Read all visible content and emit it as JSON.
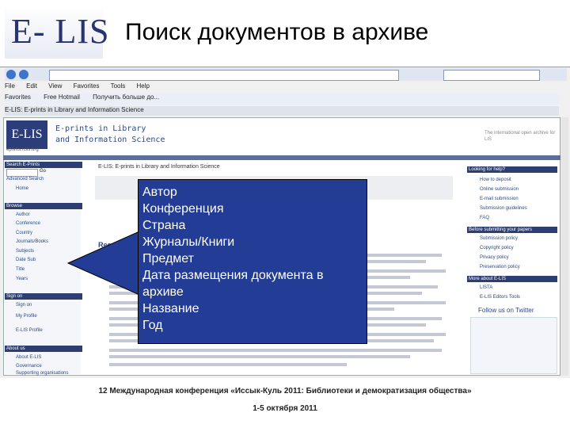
{
  "slide": {
    "logo_text": "E- LIS",
    "title": "Поиск документов в архиве"
  },
  "browser": {
    "menu": [
      "File",
      "Edit",
      "View",
      "Favorites",
      "Tools",
      "Help"
    ],
    "favorites": [
      "Favorites",
      "Free Hotmail",
      "Получить больше до..."
    ],
    "tab": "E-LIS: E-prints in Library and Information Science"
  },
  "site": {
    "logo": "E-LIS",
    "url": "eprints.rclis.org",
    "title_line1": "E-prints in Library",
    "title_line2": "and Information Science",
    "right_text": "The international open archive for LIS",
    "breadcrumb": "E-LIS: E-prints in Library and Information Science",
    "recent_heading": "Recent su",
    "sidebar": {
      "search_head": "Search E-Prints",
      "go": "Go",
      "advanced": "Advanced Search",
      "home": "Home",
      "browse_head": "Browse",
      "browse_items": [
        "Author",
        "Conference",
        "Country",
        "Journals/Books",
        "Subjects",
        "Date Sub",
        "Title",
        "Years"
      ],
      "signon_head": "Sign on",
      "signon_items": [
        "Sign on",
        "My Profile",
        "E-LIS Profile"
      ],
      "about_head": "About us",
      "about_items": [
        "About E-LIS",
        "Governance",
        "Supporting organisations"
      ]
    },
    "right": {
      "help_head": "Looking for help?",
      "help_items": [
        "How to deposit",
        "Online submission",
        "E-mail submission",
        "Submission guidelines",
        "FAQ"
      ],
      "support_head": "Before submitting your papers",
      "support_items": [
        "Submission policy",
        "Copyright policy",
        "Privacy policy",
        "Preservation policy"
      ],
      "more_head": "More about E-LIS",
      "more_items": [
        "LISTA",
        "E-LIS Editors Tools"
      ],
      "follow": "Follow us on Twitter"
    }
  },
  "callout": {
    "items": [
      "Автор",
      "Конференция",
      "Страна",
      "Журналы/Книги",
      "Предмет",
      "Дата размещения документа в архиве",
      "Название",
      "Год"
    ]
  },
  "footer": {
    "line1": "12 Международная конференция «Иссык-Куль 2011: Библиотеки и демократизация общества»",
    "line2": "1-5 октября 2011"
  },
  "colors": {
    "callout_bg": "#233c95",
    "logo_blue": "#27346f",
    "site_navy": "#2d3f72"
  }
}
